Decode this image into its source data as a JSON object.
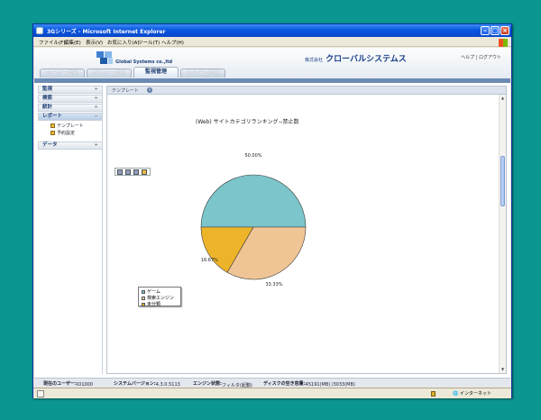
{
  "window": {
    "title": "3Gシリーズ - Microsoft Internet Explorer"
  },
  "menubar": {
    "items": [
      "ファイル(F)",
      "編集(E)",
      "表示(V)",
      "お気に入り(A)",
      "ツール(T)",
      "ヘルプ(H)"
    ]
  },
  "header": {
    "logo_text": "Global Systems co.,ltd",
    "company_prefix": "株式会社",
    "company_name": "クローバルシステムス",
    "help_link": "ヘルプ | ログアウト"
  },
  "tabs": [
    {
      "label": "ユーザー管理",
      "active": false
    },
    {
      "label": "ポリシー管理",
      "active": false
    },
    {
      "label": "監視管理",
      "active": true
    },
    {
      "label": "システム管理",
      "active": false
    }
  ],
  "sidebar": {
    "items": [
      {
        "label": "監視",
        "arrow": "+"
      },
      {
        "label": "検索",
        "arrow": "+"
      },
      {
        "label": "統計",
        "arrow": "+"
      },
      {
        "label": "レポート",
        "arrow": "−"
      },
      {
        "label": "データ",
        "arrow": "+"
      }
    ],
    "subitems": [
      "テンプレート",
      "予約設定"
    ]
  },
  "panel": {
    "tab_label": "テンプレート",
    "close_glyph": "×"
  },
  "chart_data": {
    "type": "pie",
    "title": "(Web) サイトカテゴリランキング−禁止数",
    "labels": [
      "ゲーム",
      "検索エンジン",
      "未分類"
    ],
    "values": [
      50.0,
      33.33,
      16.67
    ],
    "value_labels": [
      "50.00%",
      "33.33%",
      "16.67%"
    ],
    "colors": [
      "#7bc5cb",
      "#f0c595",
      "#edb42a"
    ],
    "legend_position": "bottom-left"
  },
  "status": {
    "current_user_label": "現在のユーザー:",
    "current_user": "IO1000",
    "version_label": "システムバージョン:",
    "version": "4.3.0.5113",
    "engine_label": "エンジン状態:",
    "engine": "フィルタ(起動)",
    "disk_label": "ディスクの空き容量:",
    "disk": "45191(MB) /3033(MB)"
  },
  "ie_status": {
    "zone": "インターネット"
  }
}
